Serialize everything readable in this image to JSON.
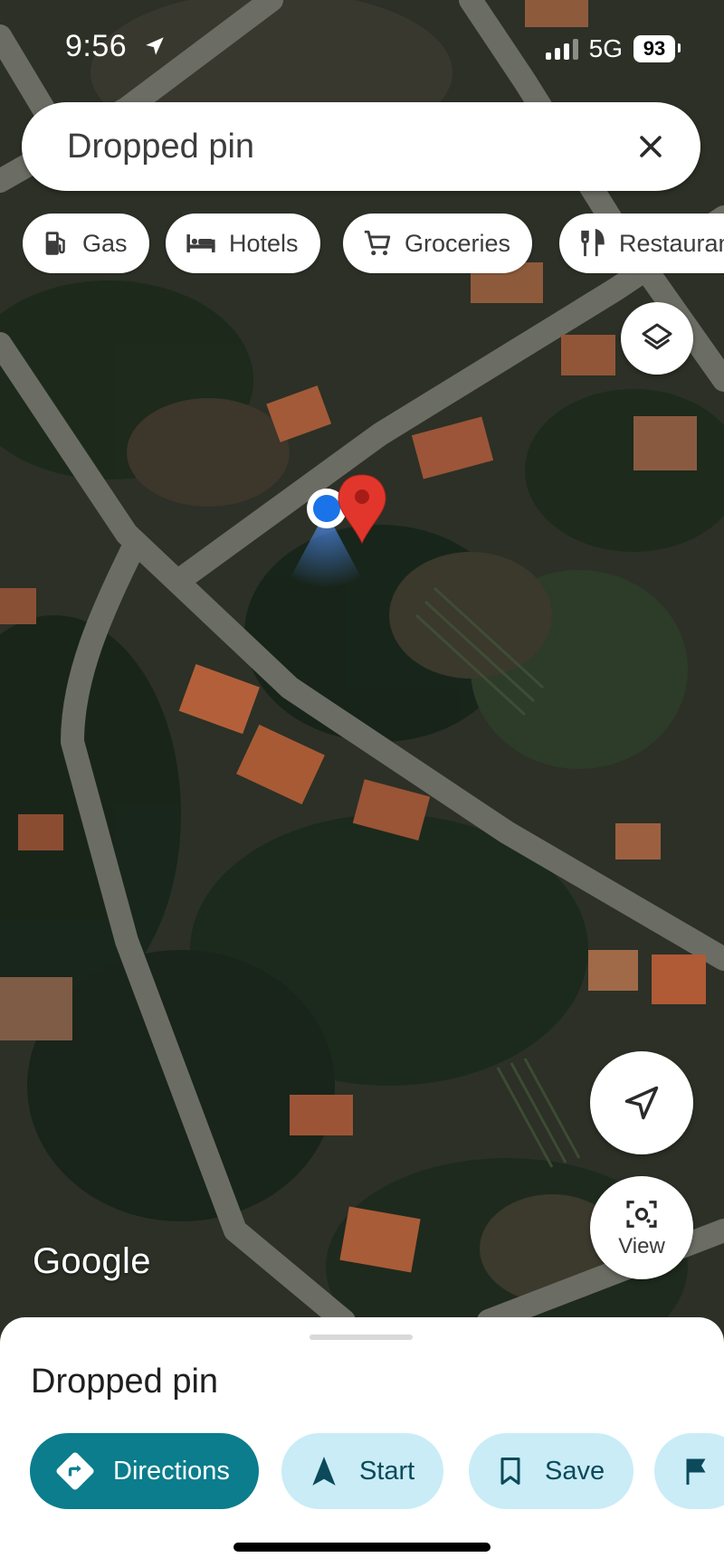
{
  "status_bar": {
    "time": "9:56",
    "network": "5G",
    "battery": "93",
    "location_icon": "location-arrow-icon",
    "signal_icon": "cellular-signal-icon"
  },
  "search": {
    "value": "Dropped pin",
    "close_icon": "close-icon"
  },
  "chips": [
    {
      "label": "Gas",
      "icon": "gas-station-icon"
    },
    {
      "label": "Hotels",
      "icon": "hotel-bed-icon"
    },
    {
      "label": "Groceries",
      "icon": "shopping-cart-icon"
    },
    {
      "label": "Restaurants",
      "icon": "restaurant-icon"
    }
  ],
  "map": {
    "type": "satellite",
    "layers_icon": "layers-icon",
    "recenter_icon": "navigation-arrow-icon",
    "view_label": "View",
    "view_icon": "lens-camera-icon",
    "attribution": "Google",
    "markers": [
      "current-location-dot",
      "dropped-pin-marker"
    ]
  },
  "sheet": {
    "title": "Dropped pin",
    "actions": [
      {
        "label": "Directions",
        "icon": "directions-icon"
      },
      {
        "label": "Start",
        "icon": "navigation-start-icon"
      },
      {
        "label": "Save",
        "icon": "bookmark-icon"
      },
      {
        "label": "",
        "icon": "flag-icon"
      }
    ]
  },
  "colors": {
    "primary_action": "#0b7d8d",
    "secondary_action": "#c9ecf7",
    "pin_red": "#e2362c",
    "location_blue": "#1a73e8"
  }
}
